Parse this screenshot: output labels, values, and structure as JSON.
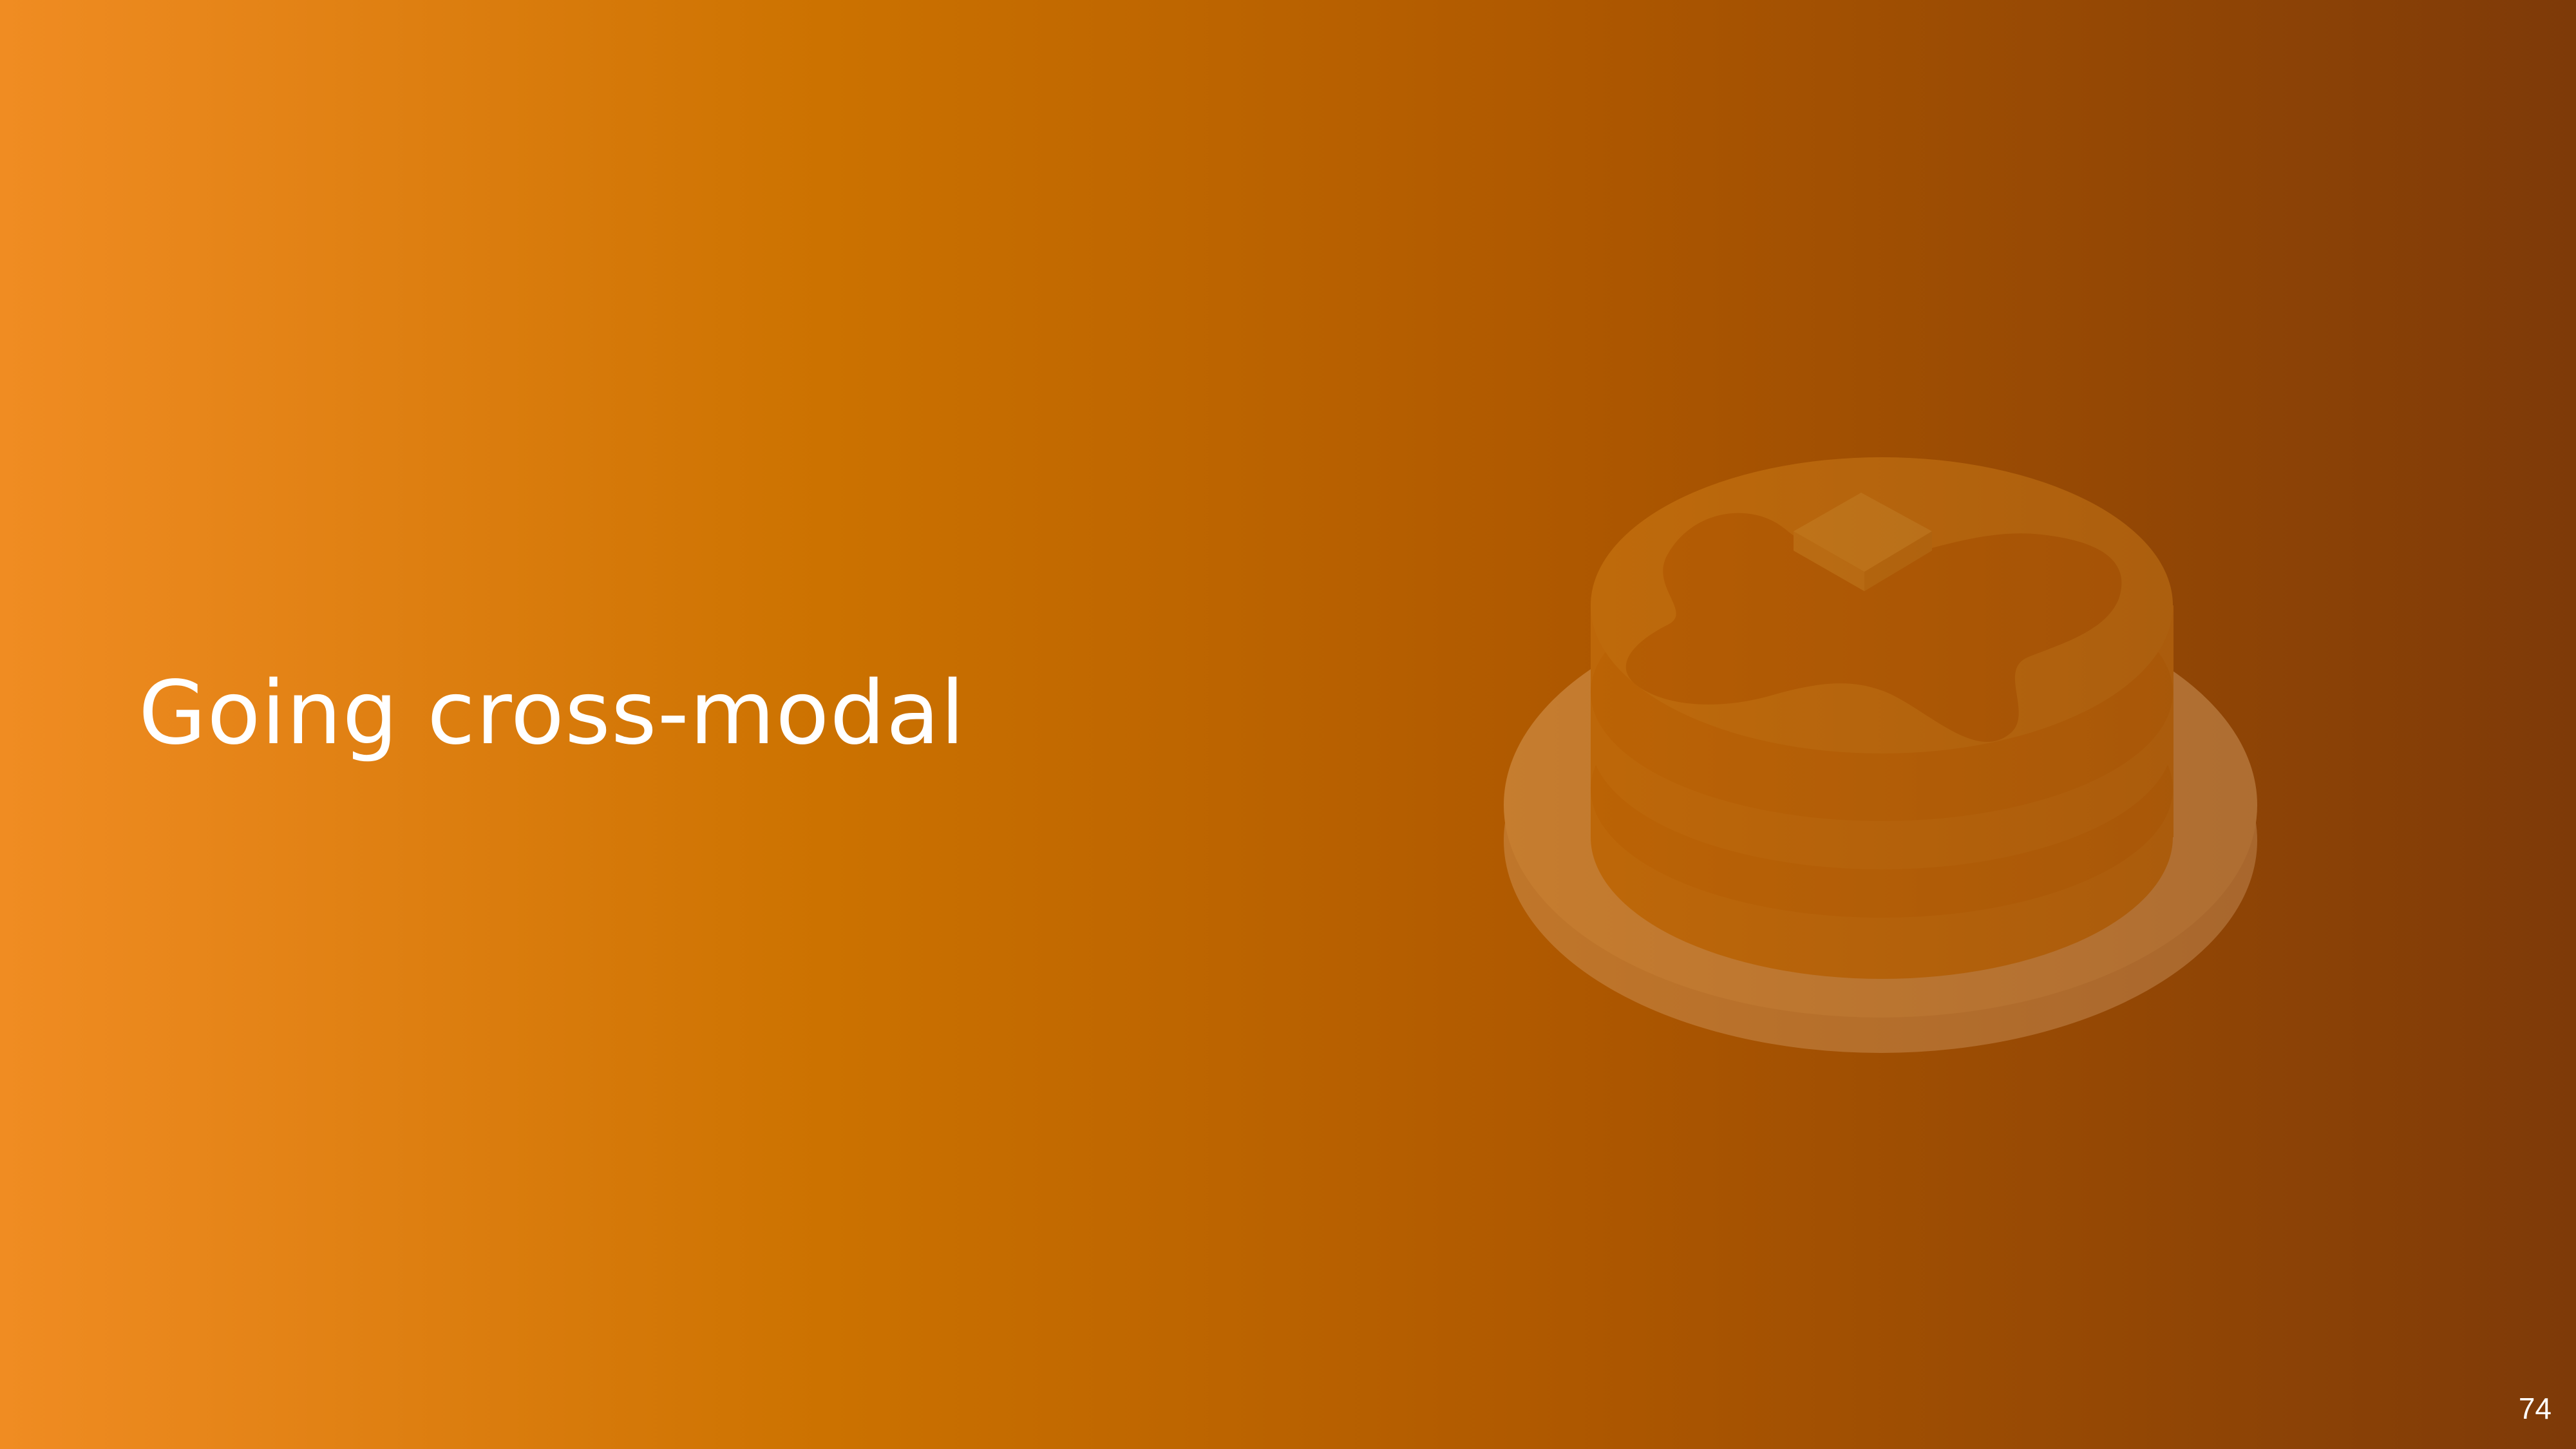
{
  "slide": {
    "title": "Going cross-modal",
    "page_number": "74",
    "illustration": "pancake-stack-icon"
  },
  "colors": {
    "gradient_start": "#F08C22",
    "gradient_mid": "#CC7200",
    "gradient_end": "#7E3A08",
    "title_text": "#FFFFFF"
  }
}
